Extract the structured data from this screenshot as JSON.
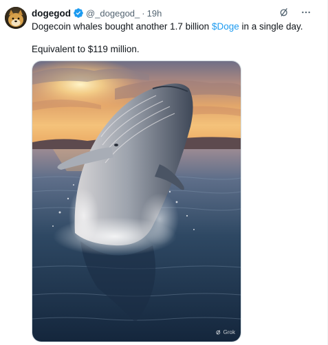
{
  "tweet": {
    "author": {
      "display_name": "dogegod",
      "handle": "@_dogegod_",
      "separator": "·",
      "timestamp": "19h",
      "verified": true
    },
    "text_line1_before": "Dogecoin whales bought another 1.7 billion ",
    "cashtag": "$Doge",
    "text_line1_after": " in a single day.",
    "text_line2": "Equivalent to $119 million.",
    "media_watermark": "Grok",
    "icons": [
      "grok-icon",
      "more-icon",
      "verified-badge-icon"
    ],
    "colors": {
      "accent": "#1d9bf0",
      "text": "#0f1419",
      "secondary": "#536471"
    }
  }
}
